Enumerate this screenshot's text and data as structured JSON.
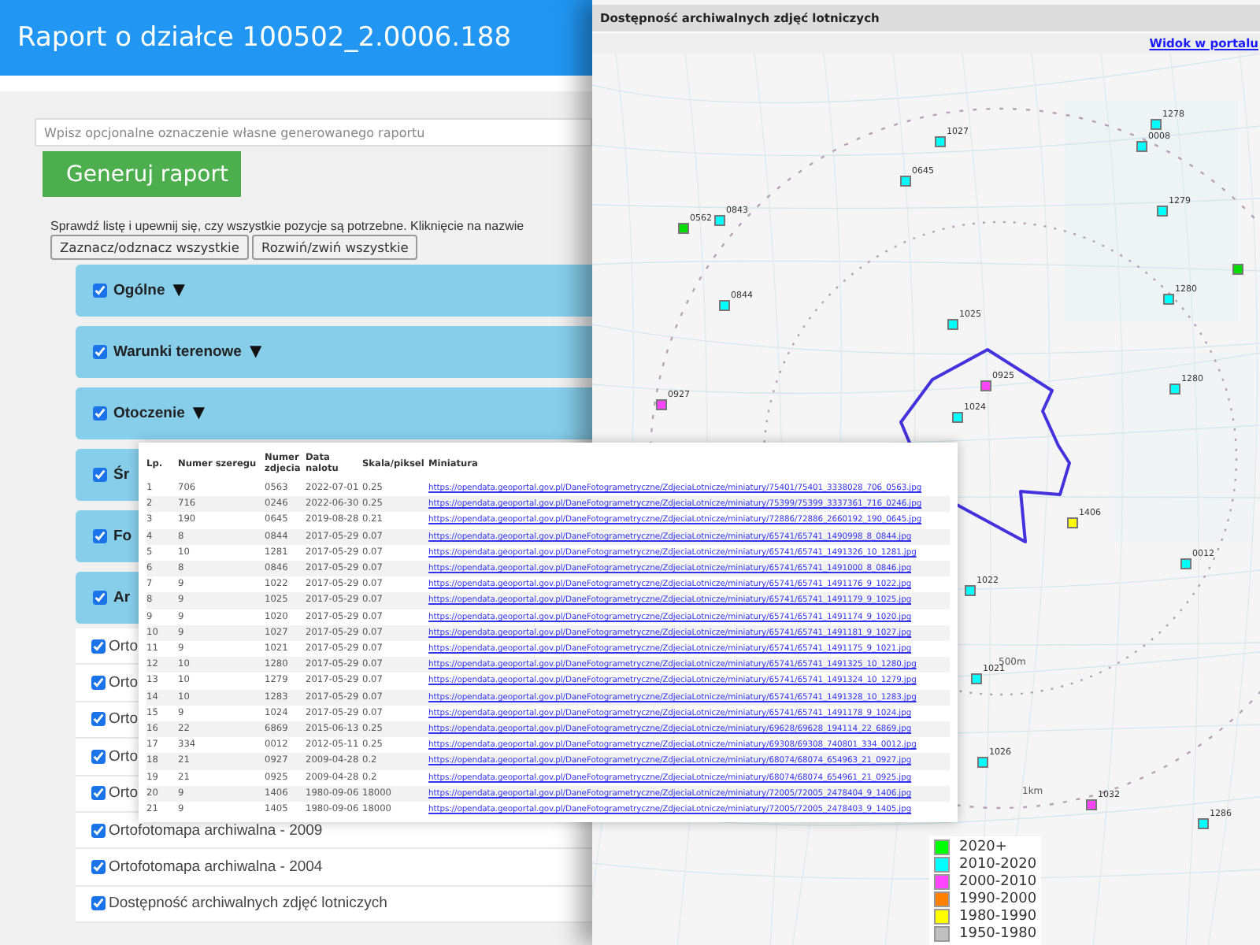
{
  "report": {
    "title": "Raport o działce 100502_2.0006.188",
    "name_field": {
      "placeholder": "Wpisz opcjonalne oznaczenie własne generowanego raportu"
    },
    "generate_button": "Generuj raport",
    "instructions": "Sprawdź listę i upewnij się, czy wszystkie pozycje są potrzebne. Kliknięcie na nazwie",
    "toolbar": [
      "Zaznacz/odznacz wszystkie",
      "Rozwiń/zwiń wszystkie"
    ],
    "sections": [
      {
        "label": "Ogólne",
        "checked": true,
        "toggle": "▼"
      },
      {
        "label": "Warunki terenowe",
        "checked": true,
        "toggle": "▼"
      },
      {
        "label": "Otoczenie",
        "checked": true,
        "toggle": "▼"
      },
      {
        "label": "Śr",
        "checked": true
      },
      {
        "label": "Fo",
        "checked": true
      },
      {
        "label": "Ar",
        "checked": true
      }
    ],
    "items": [
      {
        "label": "Orto",
        "checked": true
      },
      {
        "label": "Orto",
        "checked": true
      },
      {
        "label": "Orto",
        "checked": true
      },
      {
        "label": "Orto",
        "checked": true
      },
      {
        "label": "Orto",
        "checked": true
      },
      {
        "label": "Ortofotomapa archiwalna - 2009",
        "checked": true
      },
      {
        "label": "Ortofotomapa archiwalna - 2004",
        "checked": true
      },
      {
        "label": "Dostępność archiwalnych zdjęć lotniczych",
        "checked": true
      }
    ]
  },
  "map_window": {
    "title": "Dostępność archiwalnych zdjęć lotniczych",
    "portal_link": "Widok w portalu",
    "markers": [
      {
        "label": "0562",
        "color": "#00e000"
      },
      {
        "label": "0843",
        "color": "#00ffff"
      },
      {
        "label": "1027",
        "color": "#00ffff"
      },
      {
        "label": "0645",
        "color": "#00ffff"
      },
      {
        "label": "1278",
        "color": "#00ffff"
      },
      {
        "label": "0008",
        "color": "#00ffff"
      },
      {
        "label": "1279",
        "color": "#00ffff"
      },
      {
        "label": "0844",
        "color": "#00ffff"
      },
      {
        "label": "1025",
        "color": "#00ffff"
      },
      {
        "label": "1280",
        "color": "#00ffff"
      },
      {
        "color": "#00e000"
      },
      {
        "label": "0927",
        "color": "#ff44ff"
      },
      {
        "label": "0925",
        "color": "#ff44ff"
      },
      {
        "label": "1024",
        "color": "#00ffff"
      },
      {
        "label": "1280",
        "color": "#00ffff"
      },
      {
        "label": "1406",
        "color": "#ffff00"
      },
      {
        "label": "0012",
        "color": "#00ffff"
      },
      {
        "label": "1022",
        "color": "#00ffff"
      },
      {
        "label": "1021",
        "color": "#00ffff"
      },
      {
        "label": "1026",
        "color": "#00ffff"
      },
      {
        "label": "1032",
        "color": "#ff44ff"
      },
      {
        "label": "1286",
        "color": "#00ffff"
      }
    ],
    "range_labels": [
      "500m",
      "1km"
    ],
    "legend": [
      {
        "label": "2020+",
        "color": "#00ff00"
      },
      {
        "label": "2010-2020",
        "color": "#00ffff"
      },
      {
        "label": "2000-2010",
        "color": "#ff44ff"
      },
      {
        "label": "1990-2000",
        "color": "#ff8000"
      },
      {
        "label": "1980-1990",
        "color": "#ffff00"
      },
      {
        "label": "1950-1980",
        "color": "#c0c0c0"
      }
    ]
  },
  "photos_table": {
    "columns": [
      "Lp.",
      "Numer szeregu",
      "Numer zdjecia",
      "Data nalotu",
      "Skala/piksel",
      "Miniatura"
    ],
    "rows": [
      [
        "1",
        "706",
        "0563",
        "2022-07-01",
        "0.25",
        "https://opendata.geoportal.gov.pl/DaneFotogrametryczne/ZdjeciaLotnicze/miniatury/75401/75401_3338028_706_0563.jpg"
      ],
      [
        "2",
        "716",
        "0246",
        "2022-06-30",
        "0.25",
        "https://opendata.geoportal.gov.pl/DaneFotogrametryczne/ZdjeciaLotnicze/miniatury/75399/75399_3337361_716_0246.jpg"
      ],
      [
        "3",
        "190",
        "0645",
        "2019-08-28",
        "0.21",
        "https://opendata.geoportal.gov.pl/DaneFotogrametryczne/ZdjeciaLotnicze/miniatury/72886/72886_2660192_190_0645.jpg"
      ],
      [
        "4",
        "8",
        "0844",
        "2017-05-29",
        "0.07",
        "https://opendata.geoportal.gov.pl/DaneFotogrametryczne/ZdjeciaLotnicze/miniatury/65741/65741_1490998_8_0844.jpg"
      ],
      [
        "5",
        "10",
        "1281",
        "2017-05-29",
        "0.07",
        "https://opendata.geoportal.gov.pl/DaneFotogrametryczne/ZdjeciaLotnicze/miniatury/65741/65741_1491326_10_1281.jpg"
      ],
      [
        "6",
        "8",
        "0846",
        "2017-05-29",
        "0.07",
        "https://opendata.geoportal.gov.pl/DaneFotogrametryczne/ZdjeciaLotnicze/miniatury/65741/65741_1491000_8_0846.jpg"
      ],
      [
        "7",
        "9",
        "1022",
        "2017-05-29",
        "0.07",
        "https://opendata.geoportal.gov.pl/DaneFotogrametryczne/ZdjeciaLotnicze/miniatury/65741/65741_1491176_9_1022.jpg"
      ],
      [
        "8",
        "9",
        "1025",
        "2017-05-29",
        "0.07",
        "https://opendata.geoportal.gov.pl/DaneFotogrametryczne/ZdjeciaLotnicze/miniatury/65741/65741_1491179_9_1025.jpg"
      ],
      [
        "9",
        "9",
        "1020",
        "2017-05-29",
        "0.07",
        "https://opendata.geoportal.gov.pl/DaneFotogrametryczne/ZdjeciaLotnicze/miniatury/65741/65741_1491174_9_1020.jpg"
      ],
      [
        "10",
        "9",
        "1027",
        "2017-05-29",
        "0.07",
        "https://opendata.geoportal.gov.pl/DaneFotogrametryczne/ZdjeciaLotnicze/miniatury/65741/65741_1491181_9_1027.jpg"
      ],
      [
        "11",
        "9",
        "1021",
        "2017-05-29",
        "0.07",
        "https://opendata.geoportal.gov.pl/DaneFotogrametryczne/ZdjeciaLotnicze/miniatury/65741/65741_1491175_9_1021.jpg"
      ],
      [
        "12",
        "10",
        "1280",
        "2017-05-29",
        "0.07",
        "https://opendata.geoportal.gov.pl/DaneFotogrametryczne/ZdjeciaLotnicze/miniatury/65741/65741_1491325_10_1280.jpg"
      ],
      [
        "13",
        "10",
        "1279",
        "2017-05-29",
        "0.07",
        "https://opendata.geoportal.gov.pl/DaneFotogrametryczne/ZdjeciaLotnicze/miniatury/65741/65741_1491324_10_1279.jpg"
      ],
      [
        "14",
        "10",
        "1283",
        "2017-05-29",
        "0.07",
        "https://opendata.geoportal.gov.pl/DaneFotogrametryczne/ZdjeciaLotnicze/miniatury/65741/65741_1491328_10_1283.jpg"
      ],
      [
        "15",
        "9",
        "1024",
        "2017-05-29",
        "0.07",
        "https://opendata.geoportal.gov.pl/DaneFotogrametryczne/ZdjeciaLotnicze/miniatury/65741/65741_1491178_9_1024.jpg"
      ],
      [
        "16",
        "22",
        "6869",
        "2015-06-13",
        "0.25",
        "https://opendata.geoportal.gov.pl/DaneFotogrametryczne/ZdjeciaLotnicze/miniatury/69628/69628_194114_22_6869.jpg"
      ],
      [
        "17",
        "334",
        "0012",
        "2012-05-11",
        "0.25",
        "https://opendata.geoportal.gov.pl/DaneFotogrametryczne/ZdjeciaLotnicze/miniatury/69308/69308_740801_334_0012.jpg"
      ],
      [
        "18",
        "21",
        "0927",
        "2009-04-28",
        "0.2",
        "https://opendata.geoportal.gov.pl/DaneFotogrametryczne/ZdjeciaLotnicze/miniatury/68074/68074_654963_21_0927.jpg"
      ],
      [
        "19",
        "21",
        "0925",
        "2009-04-28",
        "0.2",
        "https://opendata.geoportal.gov.pl/DaneFotogrametryczne/ZdjeciaLotnicze/miniatury/68074/68074_654961_21_0925.jpg"
      ],
      [
        "20",
        "9",
        "1406",
        "1980-09-06",
        "18000",
        "https://opendata.geoportal.gov.pl/DaneFotogrametryczne/ZdjeciaLotnicze/miniatury/72005/72005_2478404_9_1406.jpg"
      ],
      [
        "21",
        "9",
        "1405",
        "1980-09-06",
        "18000",
        "https://opendata.geoportal.gov.pl/DaneFotogrametryczne/ZdjeciaLotnicze/miniatury/72005/72005_2478403_9_1405.jpg"
      ]
    ]
  }
}
